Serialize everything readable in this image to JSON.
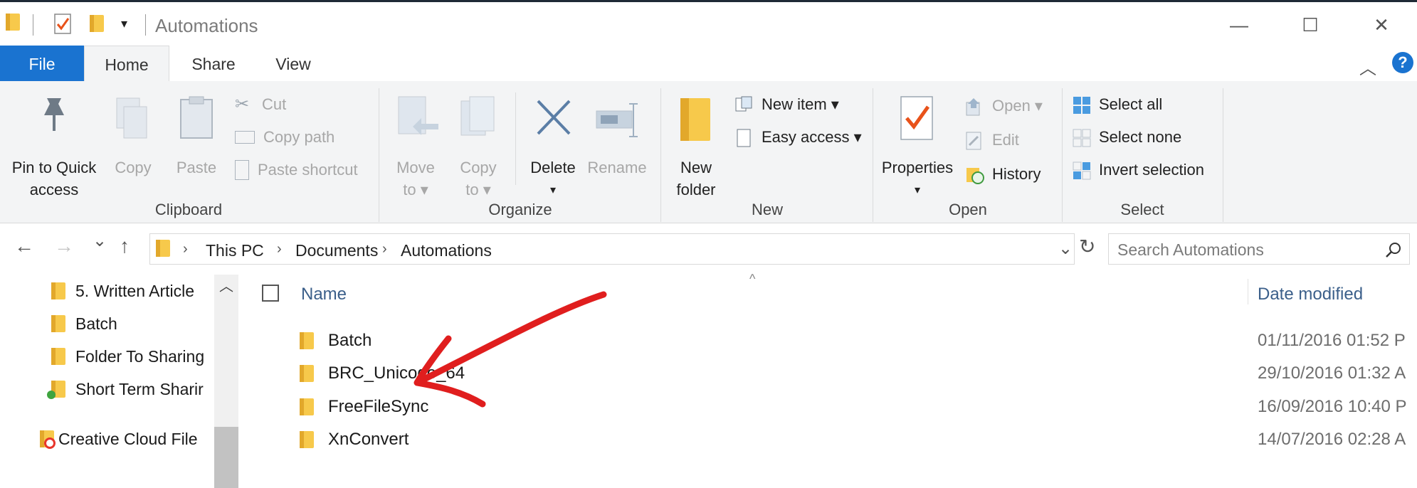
{
  "window": {
    "title": "Automations",
    "min_glyph": "—",
    "max_glyph": "☐",
    "close_glyph": "✕",
    "qa_dropdown_glyph": "▾"
  },
  "tabs": {
    "file": "File",
    "home": "Home",
    "share": "Share",
    "view": "View",
    "help_glyph": "?",
    "collapse_glyph": "︿"
  },
  "ribbon": {
    "clipboard": {
      "group_label": "Clipboard",
      "pin_line1": "Pin to Quick",
      "pin_line2": "access",
      "copy": "Copy",
      "paste": "Paste",
      "cut": "Cut",
      "copy_path": "Copy path",
      "paste_shortcut": "Paste shortcut"
    },
    "organize": {
      "group_label": "Organize",
      "move_line1": "Move",
      "move_line2": "to ▾",
      "copy_line1": "Copy",
      "copy_line2": "to ▾",
      "delete": "Delete",
      "delete_arrow": "▾",
      "rename": "Rename"
    },
    "new": {
      "group_label": "New",
      "new_folder_line1": "New",
      "new_folder_line2": "folder",
      "new_item": "New item ▾",
      "easy_access": "Easy access ▾"
    },
    "open": {
      "group_label": "Open",
      "properties": "Properties",
      "properties_arrow": "▾",
      "open": "Open ▾",
      "edit": "Edit",
      "history": "History"
    },
    "select": {
      "group_label": "Select",
      "select_all": "Select all",
      "select_none": "Select none",
      "invert": "Invert selection"
    }
  },
  "address": {
    "back_glyph": "←",
    "forward_glyph": "→",
    "recent_glyph": "⌄",
    "up_glyph": "↑",
    "crumbs": [
      "This PC",
      "Documents",
      "Automations"
    ],
    "sep_glyph": "›",
    "dropdown_glyph": "⌄",
    "refresh_glyph": "↻",
    "search_placeholder": "Search Automations"
  },
  "nav_pane": {
    "items": [
      "5. Written Article",
      "Batch",
      "Folder To Sharing",
      "Short Term Sharir",
      "Creative Cloud File"
    ],
    "scroll_up_glyph": "︿"
  },
  "file_list": {
    "sort_glyph": "^",
    "columns": {
      "name": "Name",
      "date": "Date modified"
    },
    "rows": [
      {
        "name": "Batch",
        "date": "01/11/2016 01:52 P"
      },
      {
        "name": "BRC_Unicode_64",
        "date": "29/10/2016 01:32 A"
      },
      {
        "name": "FreeFileSync",
        "date": "16/09/2016 10:40 P"
      },
      {
        "name": "XnConvert",
        "date": "14/07/2016 02:28 A"
      }
    ]
  },
  "colors": {
    "accent": "#1a73d0",
    "annotation": "#e01e1e"
  }
}
